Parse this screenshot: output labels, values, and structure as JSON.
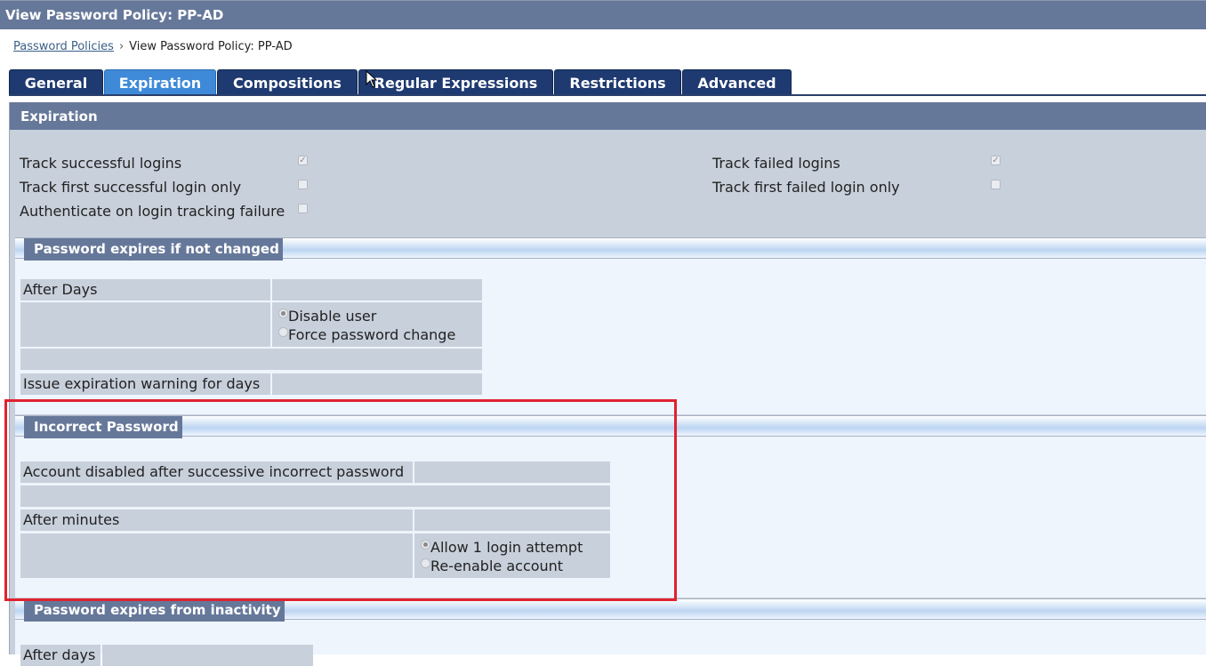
{
  "window": {
    "title": "View Password Policy: PP-AD"
  },
  "breadcrumb": {
    "link": "Password Policies",
    "separator": "›",
    "current": "View Password Policy: PP-AD"
  },
  "tabs": [
    {
      "label": "General",
      "active": false
    },
    {
      "label": "Expiration",
      "active": true
    },
    {
      "label": "Compositions",
      "active": false
    },
    {
      "label": "Regular Expressions",
      "active": false
    },
    {
      "label": "Restrictions",
      "active": false
    },
    {
      "label": "Advanced",
      "active": false
    }
  ],
  "expiration": {
    "header": "Expiration",
    "options": {
      "track_successful": {
        "label": "Track successful logins",
        "checked": true
      },
      "track_first_successful": {
        "label": "Track first successful login only",
        "checked": false
      },
      "authenticate_on_failure": {
        "label": "Authenticate on login tracking failure",
        "checked": false
      },
      "track_failed": {
        "label": "Track failed logins",
        "checked": true
      },
      "track_first_failed": {
        "label": "Track first failed login only",
        "checked": false
      }
    }
  },
  "password_expires_if_not_changed": {
    "title": "Password expires if not changed",
    "after_days_label": "After Days",
    "after_days_value": "",
    "radio_disable_user": "Disable user",
    "radio_force_change": "Force password change",
    "selected": "Disable user",
    "warning_label": "Issue expiration warning for days",
    "warning_value": ""
  },
  "incorrect_password": {
    "title": "Incorrect Password",
    "account_disabled_label": "Account disabled after successive incorrect password",
    "account_disabled_value": "",
    "after_minutes_label": "After minutes",
    "after_minutes_value": "",
    "radio_allow_login": "Allow 1 login attempt",
    "radio_reenable": "Re-enable account",
    "selected": "Allow 1 login attempt"
  },
  "password_expires_from_inactivity": {
    "title": "Password expires from inactivity",
    "after_days_label": "After days"
  },
  "colors": {
    "header": "#66789a",
    "tab": "#1e3a70",
    "tab_active": "#3e8ad9",
    "highlight": "#e02230"
  }
}
